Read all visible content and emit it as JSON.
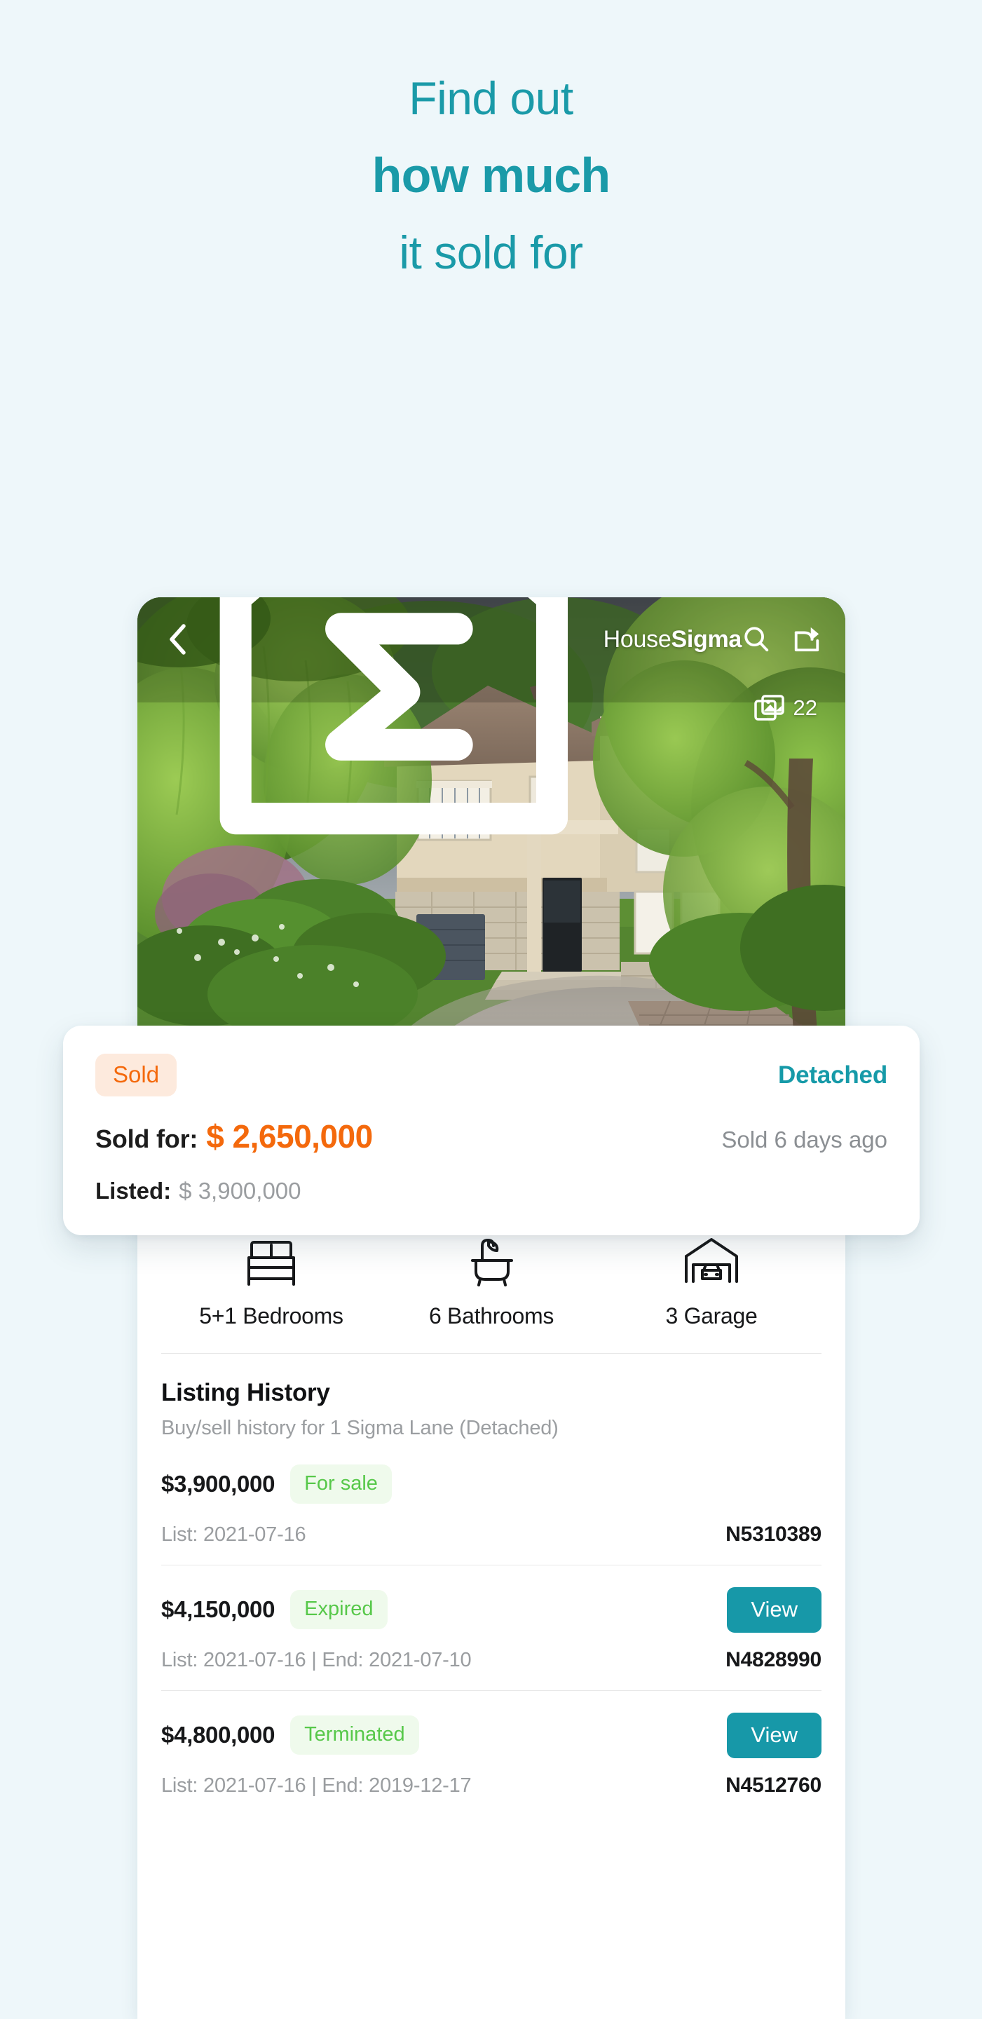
{
  "theme": {
    "page_background": "#eef7fa",
    "teal": "#1a9aa8",
    "orange": "#f4690c",
    "orange_badge_bg": "#fdeadd",
    "green": "#57c84a",
    "green_badge_bg": "#effaec",
    "muted_grey": "#9a9da0"
  },
  "hero": {
    "line1": "Find out",
    "line2": "how much",
    "line3": "it sold for"
  },
  "phone": {
    "photo_bar": {
      "back_icon": "chevron-left-icon",
      "brand_prefix": "House",
      "brand_suffix": "Sigma",
      "logo_icon": "housesigma-logo-icon",
      "search_icon": "search-icon",
      "share_icon": "share-icon"
    },
    "photo_count": {
      "icon": "photos-icon",
      "count": "22"
    },
    "sold_card": {
      "status_badge": "Sold",
      "property_type": "Detached",
      "sold_for_label": "Sold for:",
      "sold_for_value": "$ 2,650,000",
      "sold_ago": "Sold 6 days ago",
      "listed_label": "Listed:",
      "listed_value": "$ 3,900,000"
    },
    "facts": [
      {
        "icon": "bed-icon",
        "label": "5+1 Bedrooms"
      },
      {
        "icon": "bathtub-icon",
        "label": "6 Bathrooms"
      },
      {
        "icon": "garage-icon",
        "label": "3 Garage"
      }
    ],
    "listing_history": {
      "title": "Listing History",
      "subtitle": "Buy/sell history for 1 Sigma Lane (Detached)",
      "rows": [
        {
          "price": "$3,900,000",
          "status": "For sale",
          "dates": "List: 2021-07-16",
          "mls": "N5310389",
          "view_label": "",
          "has_view": false
        },
        {
          "price": "$4,150,000",
          "status": "Expired",
          "dates": "List: 2021-07-16 | End: 2021-07-10",
          "mls": "N4828990",
          "view_label": "View",
          "has_view": true
        },
        {
          "price": "$4,800,000",
          "status": "Terminated",
          "dates": "List: 2021-07-16 | End: 2019-12-17",
          "mls": "N4512760",
          "view_label": "View",
          "has_view": true
        }
      ]
    }
  }
}
